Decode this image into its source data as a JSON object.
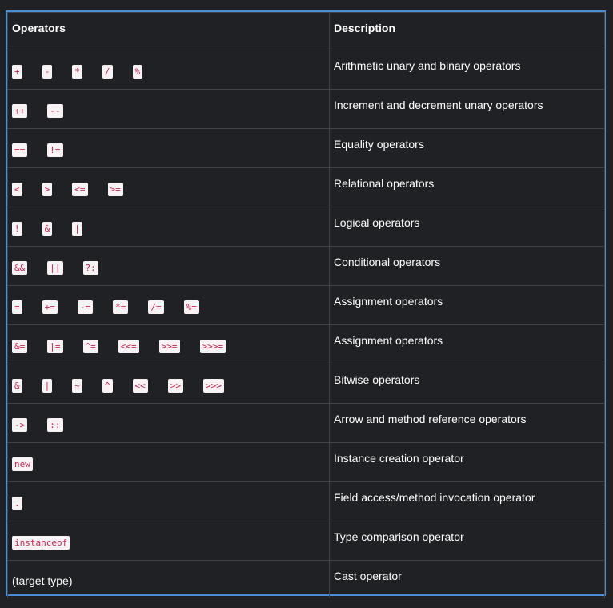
{
  "table": {
    "headers": [
      "Operators",
      "Description"
    ],
    "rows": [
      {
        "ops": [
          "+",
          "-",
          "*",
          "/",
          "%"
        ],
        "desc": "Arithmetic unary and binary operators"
      },
      {
        "ops": [
          "++",
          "--"
        ],
        "desc": "Increment and decrement unary operators"
      },
      {
        "ops": [
          "==",
          "!="
        ],
        "desc": "Equality operators"
      },
      {
        "ops": [
          "<",
          ">",
          "<=",
          ">="
        ],
        "desc": "Relational operators"
      },
      {
        "ops": [
          "!",
          "&",
          "|"
        ],
        "desc": "Logical operators"
      },
      {
        "ops": [
          "&&",
          "||",
          "?:"
        ],
        "desc": "Conditional operators"
      },
      {
        "ops": [
          "=",
          "+=",
          "-=",
          "*=",
          "/=",
          "%="
        ],
        "desc": "Assignment operators"
      },
      {
        "ops": [
          "&=",
          "|=",
          "^=",
          "<<=",
          ">>=",
          ">>>="
        ],
        "desc": "Assignment operators"
      },
      {
        "ops": [
          "&",
          "|",
          "~",
          "^",
          "<<",
          ">>",
          ">>>"
        ],
        "desc": "Bitwise operators"
      },
      {
        "ops": [
          "->",
          "::"
        ],
        "desc": "Arrow and method reference operators"
      },
      {
        "ops": [
          "new"
        ],
        "desc": "Instance creation operator"
      },
      {
        "ops": [
          "."
        ],
        "desc": "Field access/method invocation operator"
      },
      {
        "ops": [
          "instanceof"
        ],
        "desc": "Type comparison operator"
      },
      {
        "plain": "(target type)",
        "desc": "Cast operator"
      }
    ]
  },
  "colors": {
    "background": "#202124",
    "border_accent": "#4a8fd8",
    "code_text": "#c7254e",
    "code_bg": "#f9f2f4"
  }
}
